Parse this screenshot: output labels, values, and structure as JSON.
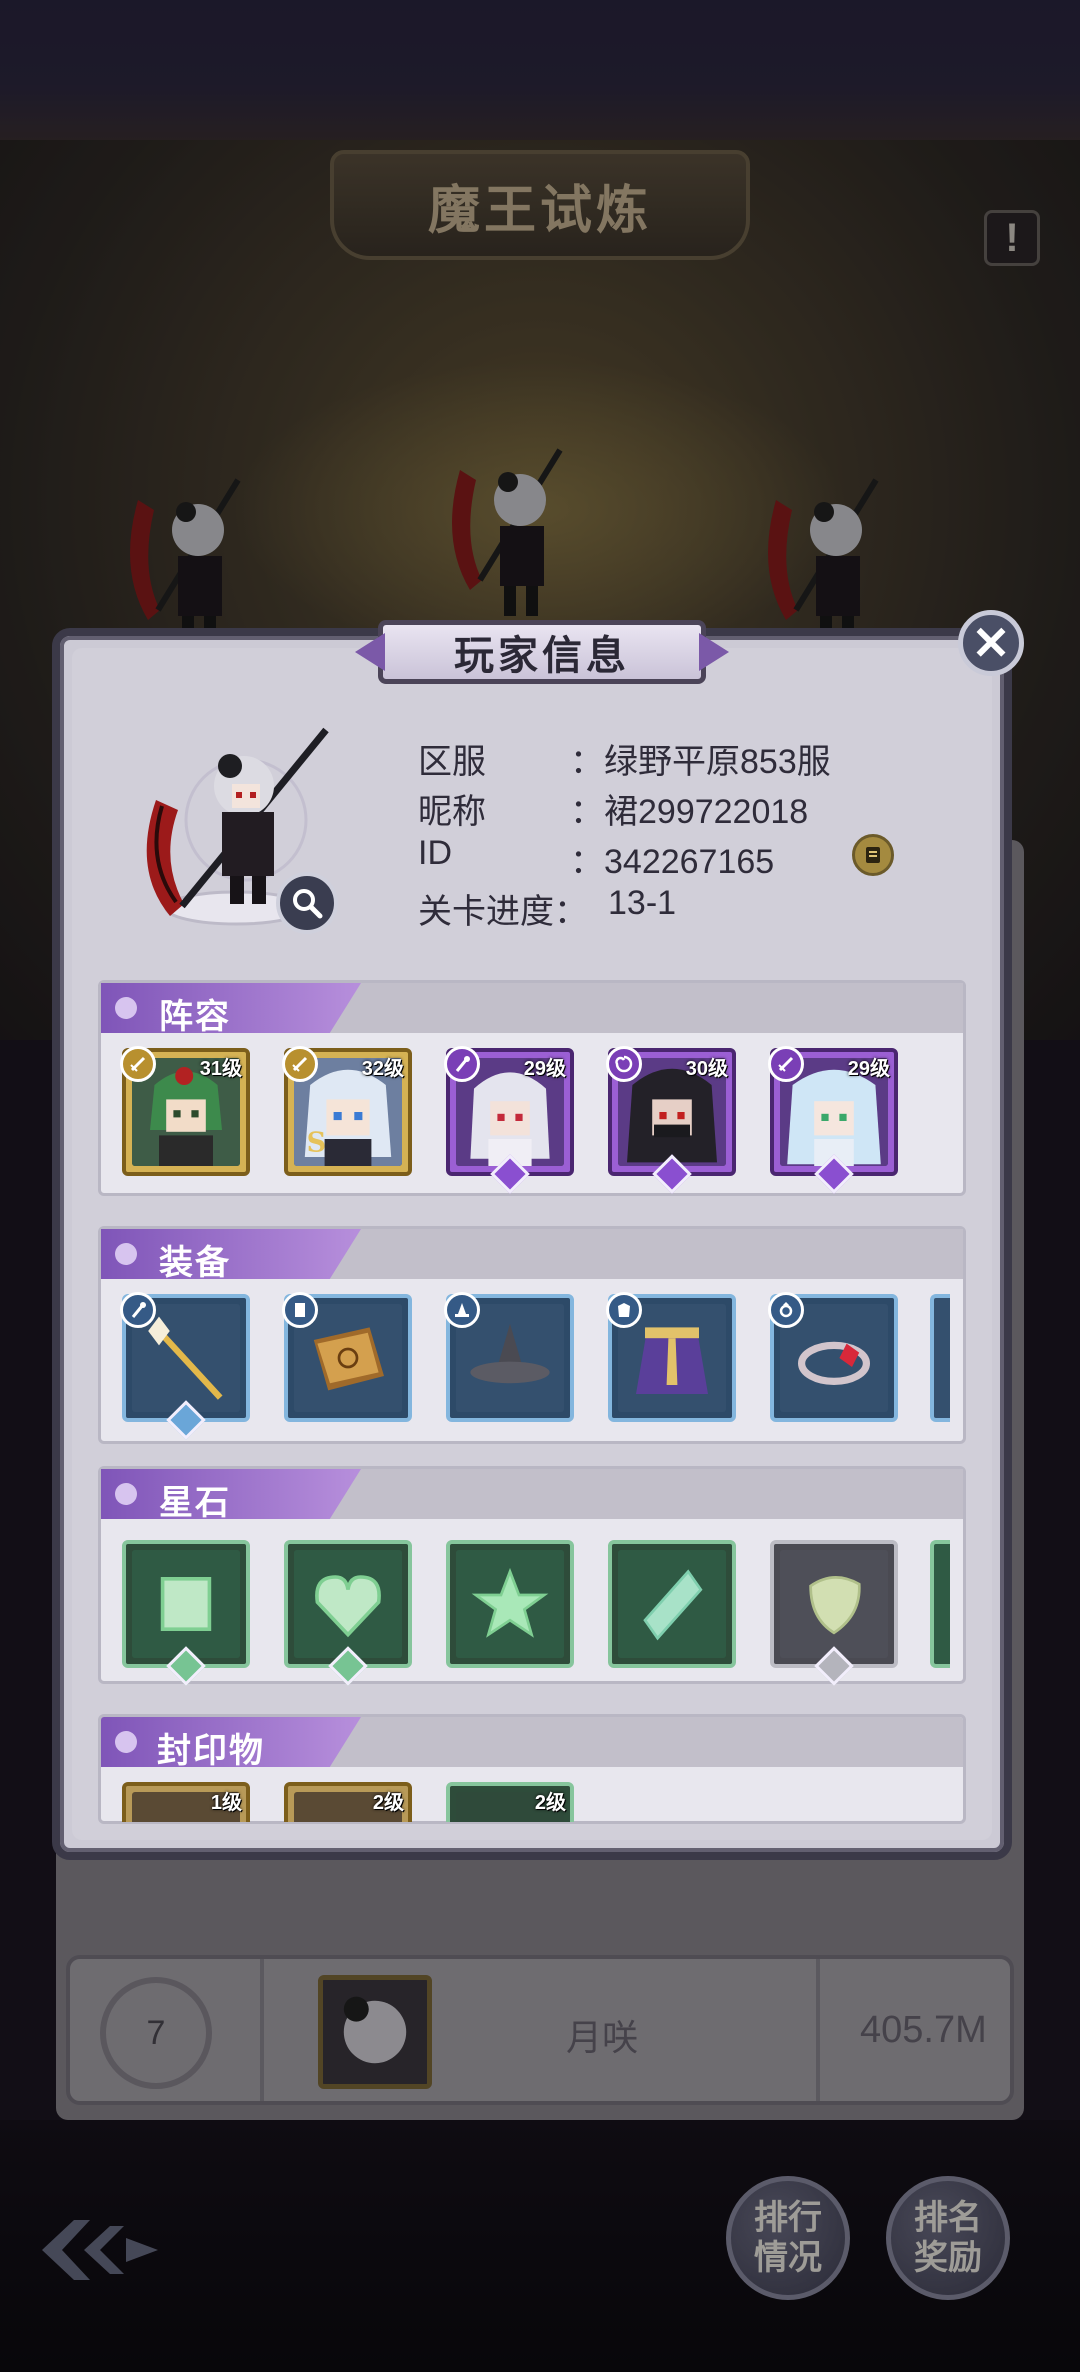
{
  "background": {
    "title": "魔王试炼",
    "info_icon": "exclamation-icon",
    "rank_row": {
      "rank": "7",
      "name": "月咲",
      "score": "405.7M"
    },
    "nav": {
      "ranking_status": [
        "排行",
        "情况"
      ],
      "ranking_rewards": [
        "排名",
        "奖励"
      ]
    }
  },
  "dialog": {
    "title": "玩家信息",
    "close_icon": "close-icon",
    "info": {
      "server_label": "区服",
      "server_value": "：绿野平原853服",
      "nickname_label": "昵称",
      "nickname_value": "：裙299722018",
      "id_label": "ID",
      "id_value": "：342267165",
      "progress_label": "关卡进度：",
      "progress_value": "13-1"
    },
    "sections": {
      "lineup": {
        "label": "阵容",
        "heroes": [
          {
            "level": "31级",
            "rarity": "gold",
            "class_icon": "sword-icon"
          },
          {
            "level": "32级",
            "rarity": "gold",
            "class_icon": "sword-icon"
          },
          {
            "level": "29级",
            "rarity": "purple",
            "class_icon": "staff-icon"
          },
          {
            "level": "30级",
            "rarity": "purple",
            "class_icon": "swirl-icon"
          },
          {
            "level": "29级",
            "rarity": "purple",
            "class_icon": "sword-icon"
          }
        ]
      },
      "equipment": {
        "label": "装备",
        "items": [
          {
            "name": "staff",
            "type_icon": "staff-icon"
          },
          {
            "name": "spellbook",
            "type_icon": "book-icon"
          },
          {
            "name": "witch-hat",
            "type_icon": "hat-icon"
          },
          {
            "name": "cloak",
            "type_icon": "armor-icon"
          },
          {
            "name": "ring",
            "type_icon": "ring-icon"
          }
        ]
      },
      "star_stones": {
        "label": "星石",
        "items": [
          {
            "shape": "square-gem",
            "color": "green"
          },
          {
            "shape": "heart-gem",
            "color": "green"
          },
          {
            "shape": "star-gem",
            "color": "green"
          },
          {
            "shape": "diamond-gem",
            "color": "green"
          },
          {
            "shape": "round-gem",
            "color": "gray"
          }
        ]
      },
      "seals": {
        "label": "封印物",
        "items": [
          {
            "level": "1级"
          },
          {
            "level": "2级"
          },
          {
            "level": "2级"
          }
        ]
      }
    }
  },
  "colors": {
    "accent_purple": "#8a5cc4",
    "dialog_bg": "#d1cfd9",
    "gold_frame": "#d5b254",
    "blue_frame": "#83b6de",
    "green_frame": "#86c59c"
  }
}
